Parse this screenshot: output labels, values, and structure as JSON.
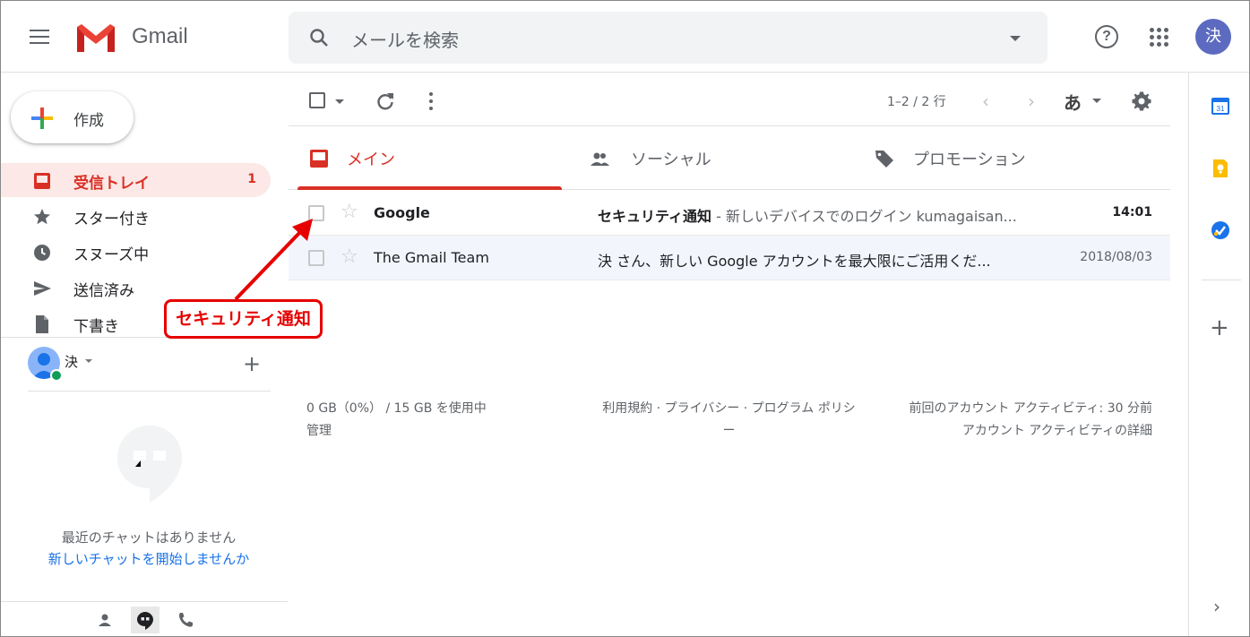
{
  "header": {
    "app_name": "Gmail",
    "search_placeholder": "メールを検索",
    "avatar_initial": "決"
  },
  "sidebar": {
    "compose_label": "作成",
    "items": [
      {
        "label": "受信トレイ",
        "count": "1",
        "icon": "inbox-icon"
      },
      {
        "label": "スター付き",
        "icon": "star-icon"
      },
      {
        "label": "スヌーズ中",
        "icon": "clock-icon"
      },
      {
        "label": "送信済み",
        "icon": "send-icon"
      },
      {
        "label": "下書き",
        "icon": "draft-icon"
      }
    ],
    "user_name": "決",
    "no_chat": "最近のチャットはありません",
    "new_chat": "新しいチャットを開始しませんか"
  },
  "toolbar": {
    "pager": "1–2 / 2 行",
    "ime": "あ"
  },
  "tabs": [
    {
      "label": "メイン",
      "icon": "inbox-icon",
      "active": true
    },
    {
      "label": "ソーシャル",
      "icon": "people-icon",
      "active": false
    },
    {
      "label": "プロモーション",
      "icon": "tag-icon",
      "active": false
    }
  ],
  "emails": [
    {
      "sender": "Google",
      "subject": "セキュリティ通知",
      "snippet": " - 新しいデバイスでのログイン kumagaisan...",
      "date": "14:01",
      "unread": true
    },
    {
      "sender": "The Gmail Team",
      "subject": "決 さん、新しい Google アカウントを最大限にご活用くだ...",
      "snippet": "",
      "date": "2018/08/03",
      "unread": false
    }
  ],
  "footer": {
    "storage": "0 GB（0%） / 15 GB を使用中",
    "manage": "管理",
    "links_line1": "利用規約 · プライバシー · プログラム ポリシ",
    "links_line2": "ー",
    "activity": "前回のアカウント アクティビティ: 30 分前",
    "activity_details": "アカウント アクティビティの詳細"
  },
  "annotation": {
    "callout_text": "セキュリティ通知",
    "color": "#e60000"
  },
  "colors": {
    "accent_red": "#d93025",
    "link_blue": "#1a73e8",
    "avatar_bg": "#5c6bc0"
  }
}
